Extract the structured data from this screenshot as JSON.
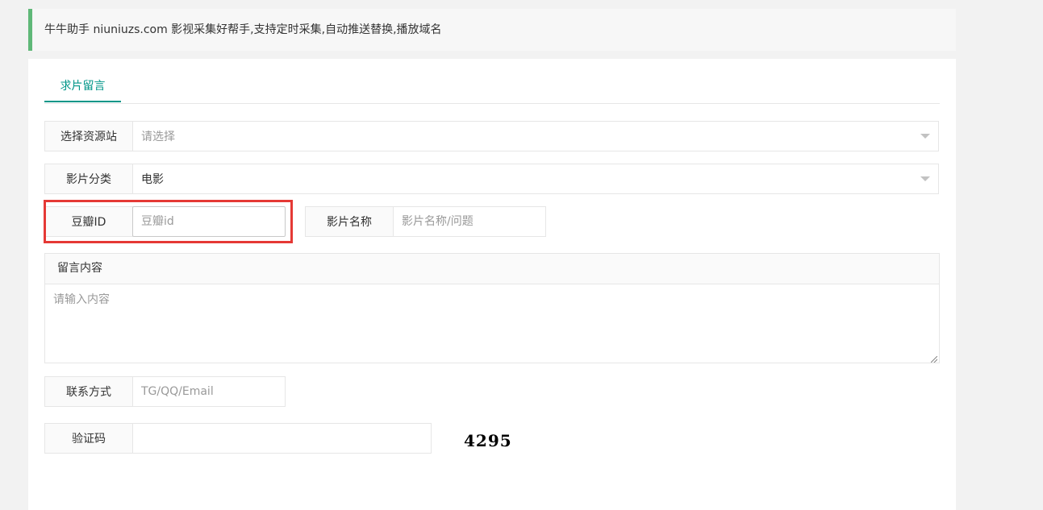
{
  "notice": {
    "text": "牛牛助手 niuniuzs.com 影视采集好帮手,支持定时采集,自动推送替换,播放域名"
  },
  "tabs": [
    {
      "label": "求片留言"
    }
  ],
  "form": {
    "source_site": {
      "label": "选择资源站",
      "placeholder": "请选择"
    },
    "category": {
      "label": "影片分类",
      "value": "电影"
    },
    "douban_id": {
      "label": "豆瓣ID",
      "placeholder": "豆瓣id"
    },
    "movie_name": {
      "label": "影片名称",
      "placeholder": "影片名称/问题"
    },
    "message": {
      "label": "留言内容",
      "placeholder": "请输入内容"
    },
    "contact": {
      "label": "联系方式",
      "placeholder": "TG/QQ/Email"
    },
    "captcha": {
      "label": "验证码",
      "value": "",
      "code": "4295"
    }
  },
  "colors": {
    "accent": "#009688",
    "notice_border": "#5fb878",
    "highlight": "#e53935"
  }
}
